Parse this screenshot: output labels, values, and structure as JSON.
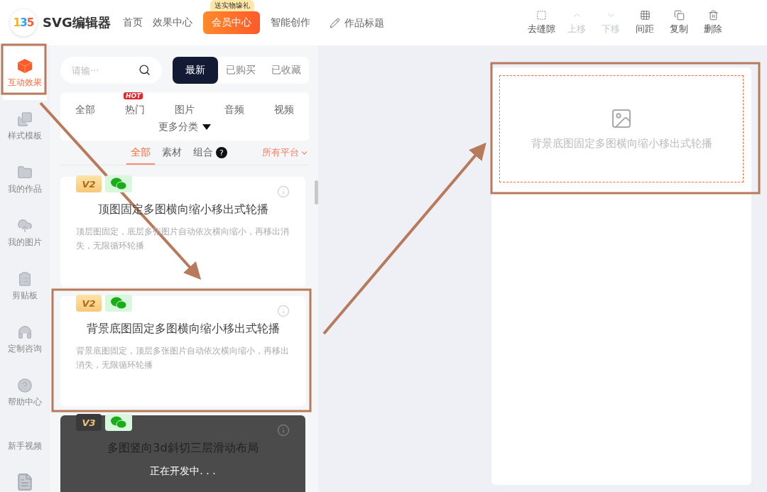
{
  "header": {
    "logo_mark": "135",
    "logo_text": "SVG编辑器",
    "nav": [
      {
        "label": "首页",
        "kind": "link"
      },
      {
        "label": "效果中心",
        "kind": "link"
      },
      {
        "label": "会员中心",
        "kind": "promo",
        "badge": "送实物壕礼"
      },
      {
        "label": "智能创作",
        "kind": "link"
      }
    ],
    "title_field": {
      "placeholder": "作品标题"
    },
    "toolbar": [
      {
        "label": "去缝隙",
        "disabled": false
      },
      {
        "label": "上移",
        "disabled": true
      },
      {
        "label": "下移",
        "disabled": true
      },
      {
        "label": "间距",
        "disabled": false
      },
      {
        "label": "复制",
        "disabled": false
      },
      {
        "label": "删除",
        "disabled": false
      }
    ]
  },
  "sidebar": {
    "items": [
      {
        "label": "互动效果",
        "selected": true
      },
      {
        "label": "样式模板",
        "selected": false
      },
      {
        "label": "我的作品",
        "selected": false
      },
      {
        "label": "我的图片",
        "selected": false
      },
      {
        "label": "剪贴板",
        "selected": false
      },
      {
        "label": "定制咨询",
        "selected": false
      },
      {
        "label": "帮助中心",
        "selected": false
      },
      {
        "label": "新手视频",
        "selected": false
      }
    ]
  },
  "panel": {
    "search": {
      "placeholder": "请输···"
    },
    "tabs": [
      {
        "label": "最新",
        "selected": true
      },
      {
        "label": "已购买",
        "selected": false
      },
      {
        "label": "已收藏",
        "selected": false
      }
    ],
    "categories": [
      {
        "label": "全部"
      },
      {
        "label": "热门",
        "badge": "HOT"
      },
      {
        "label": "图片"
      },
      {
        "label": "音频"
      },
      {
        "label": "视频"
      }
    ],
    "more_categories": "更多分类",
    "subtabs": [
      {
        "label": "全部",
        "selected": true
      },
      {
        "label": "素材",
        "selected": false
      },
      {
        "label": "组合",
        "selected": false,
        "help": "?"
      }
    ],
    "platform": "所有平台",
    "cards": [
      {
        "version": "V2",
        "title": "顶图固定多图横向缩小移出式轮播",
        "description": "顶层图固定，底层多张图片自动依次横向缩小，再移出消失，无限循环轮播",
        "in_development": false
      },
      {
        "version": "V2",
        "title": "背景底图固定多图横向缩小移出式轮播",
        "description": "背景底图固定，顶层多张图片自动依次横向缩小，再移出消失，无限循环轮播",
        "in_development": false
      },
      {
        "version": "V3",
        "title": "多图竖向3d斜切三层滑动布局",
        "in_development": true,
        "overlay_text": "正在开发中. . ."
      }
    ]
  },
  "canvas": {
    "placeholder_text": "背景底图固定多图横向缩小移出式轮播"
  }
}
